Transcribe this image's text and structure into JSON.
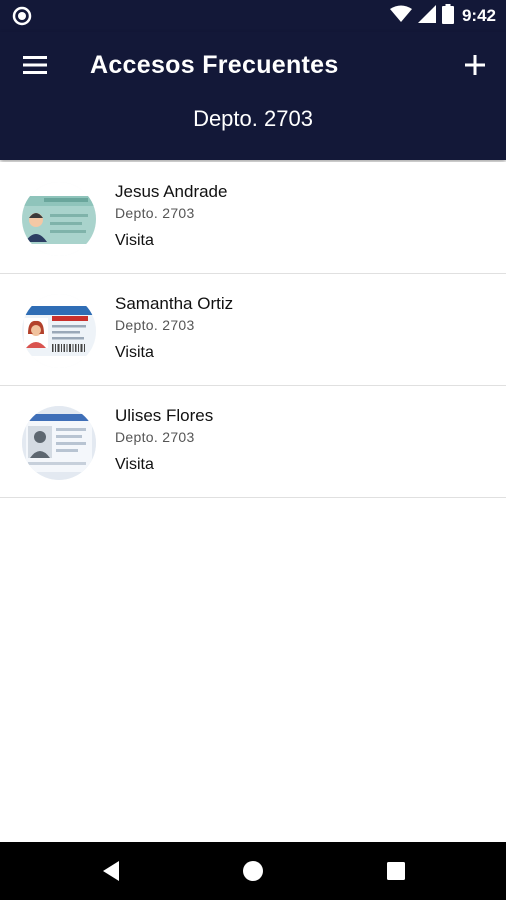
{
  "status_bar": {
    "time": "9:42",
    "icons": [
      "notification-circle-icon",
      "wifi-icon",
      "signal-icon",
      "battery-icon"
    ]
  },
  "app_bar": {
    "title": "Accesos Frecuentes",
    "subtitle": "Depto. 2703",
    "menu_icon": "hamburger-menu-icon",
    "add_icon": "plus-icon"
  },
  "colors": {
    "header_bg": "#131838",
    "text_primary": "#111111",
    "text_secondary": "#555555",
    "divider": "#e0e0e0"
  },
  "items": [
    {
      "name": "Jesus Andrade",
      "dept": "Depto. 2703",
      "type": "Visita",
      "avatar": "driver-license-male-icon"
    },
    {
      "name": "Samantha Ortiz",
      "dept": "Depto. 2703",
      "type": "Visita",
      "avatar": "driver-license-female-icon"
    },
    {
      "name": "Ulises Flores",
      "dept": "Depto. 2703",
      "type": "Visita",
      "avatar": "id-card-placeholder-icon"
    }
  ],
  "nav_bar": {
    "buttons": [
      "back-triangle-icon",
      "home-circle-icon",
      "recents-square-icon"
    ]
  }
}
